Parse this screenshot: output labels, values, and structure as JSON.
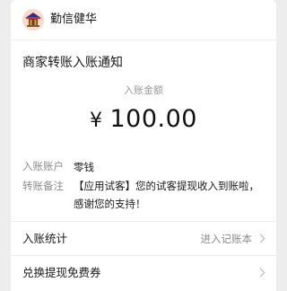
{
  "header": {
    "brand_name": "勤信健华",
    "logo_icon": "temple-avatar-icon"
  },
  "notice": {
    "title": "商家转账入账通知",
    "amount_label": "入账金额",
    "currency_symbol": "¥",
    "amount_value": "100.00"
  },
  "fields": [
    {
      "label": "入账账户",
      "value": "零钱"
    },
    {
      "label": "转账备注",
      "value": "【应用试客】您的试客提现收入到账啦，感谢您的支持！"
    }
  ],
  "rows": [
    {
      "label": "入账统计",
      "action": "进入记账本"
    },
    {
      "label": "兑换提现免费券",
      "action": ""
    }
  ],
  "colors": {
    "background": "#ededed",
    "card": "#ffffff",
    "muted_text": "#8c8c8c"
  }
}
